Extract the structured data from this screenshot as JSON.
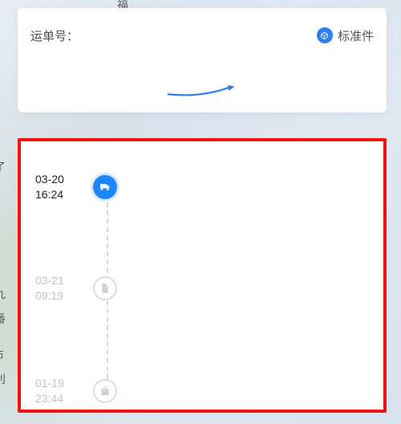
{
  "header": {
    "tracking_label": "运单号：",
    "tracking_value": "",
    "type_label": "标准件"
  },
  "timeline": {
    "items": [
      {
        "date": "03-20",
        "time": "16:24",
        "icon": "truck-icon",
        "active": true
      },
      {
        "date": "03-21",
        "time": "09:19",
        "icon": "document-icon",
        "active": false
      },
      {
        "date": "01-19",
        "time": "23:44",
        "icon": "gift-icon",
        "active": false
      }
    ]
  }
}
